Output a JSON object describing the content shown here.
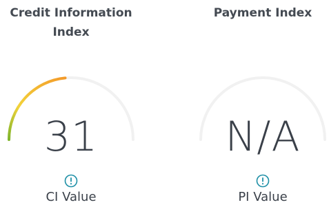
{
  "credit_index": {
    "title_line1": "Credit Information",
    "title_line2": "Index",
    "value": "31",
    "label": "CI Value",
    "fill_fraction": 0.47
  },
  "payment_index": {
    "title_line1": "Payment Index",
    "value": "N/A",
    "label": "PI Value",
    "fill_fraction": 0
  },
  "colors": {
    "track": "#f1f1f1",
    "gauge_start": "#7fb52a",
    "gauge_mid": "#f3d33a",
    "gauge_end": "#f39a2a",
    "info_icon": "#1d8fa6",
    "text": "#3a4049"
  },
  "icons": {
    "info": "info-circle-icon"
  }
}
